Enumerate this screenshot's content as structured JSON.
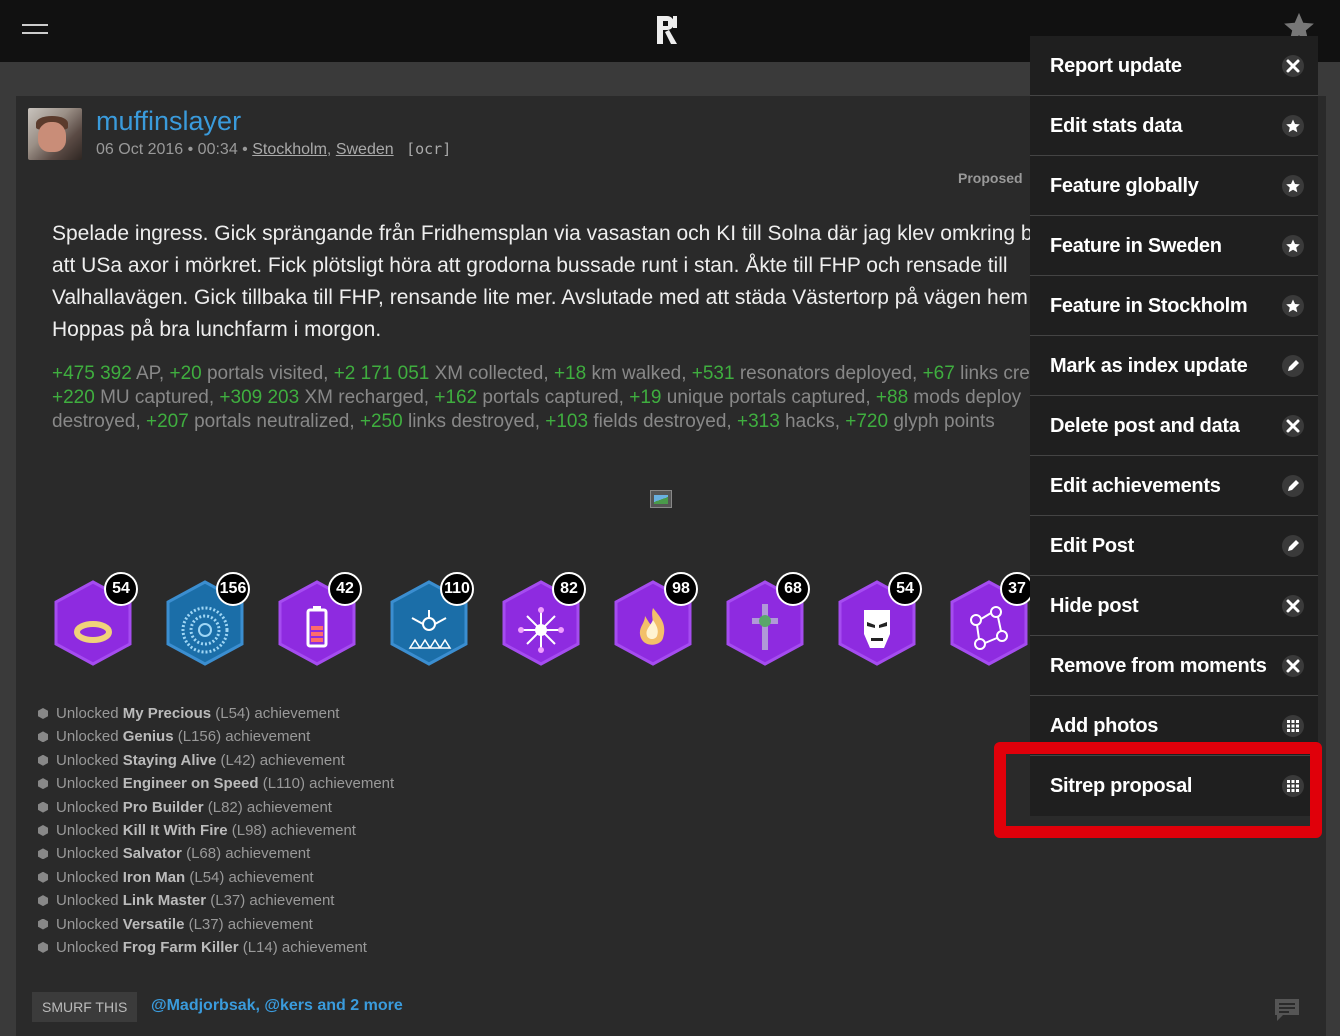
{
  "post": {
    "username": "muffinslayer",
    "date": "06 Oct 2016",
    "time": "00:34",
    "city": "Stockholm",
    "country": "Sweden",
    "ocr_tag": "[ocr]",
    "proposed_label": "Proposed",
    "text_lines": [
      "Spelade ingress. Gick sprängande från Fridhemsplan via vasastan och KI till Solna där jag klev omkring b",
      "att USa axor i mörkret. Fick plötsligt höra att grodorna bussade runt i stan. Åkte till FHP och rensade till",
      "Valhallavägen. Gick tillbaka till FHP, rensande lite mer. Avslutade med att städa Västertorp på vägen hem",
      "Hoppas på bra lunchfarm i morgon."
    ]
  },
  "stats": [
    [
      {
        "v": "+475 392",
        "t": " AP, "
      },
      {
        "v": "+20",
        "t": " portals visited, "
      },
      {
        "v": "+2 171 051",
        "t": " XM collected, "
      },
      {
        "v": "+18",
        "t": " km walked, "
      },
      {
        "v": "+531",
        "t": " resonators deployed, "
      },
      {
        "v": "+67",
        "t": " links cre"
      }
    ],
    [
      {
        "v": "+220",
        "t": " MU captured, "
      },
      {
        "v": "+309 203",
        "t": " XM recharged, "
      },
      {
        "v": "+162",
        "t": " portals captured, "
      },
      {
        "v": "+19",
        "t": " unique portals captured, "
      },
      {
        "v": "+88",
        "t": " mods deploy"
      }
    ],
    [
      {
        "v": "",
        "t": "destroyed, "
      },
      {
        "v": "+207",
        "t": " portals neutralized, "
      },
      {
        "v": "+250",
        "t": " links destroyed, "
      },
      {
        "v": "+103",
        "t": " fields destroyed, "
      },
      {
        "v": "+313",
        "t": " hacks, "
      },
      {
        "v": "+720",
        "t": " glyph points"
      }
    ]
  ],
  "badges": [
    {
      "count": "54",
      "icon": "ring-icon",
      "color": "#8e2be0"
    },
    {
      "count": "156",
      "icon": "genius-icon",
      "color": "#1b6ea8"
    },
    {
      "count": "42",
      "icon": "battery-icon",
      "color": "#8e2be0"
    },
    {
      "count": "110",
      "icon": "engineer-icon",
      "color": "#1b6ea8"
    },
    {
      "count": "82",
      "icon": "builder-icon",
      "color": "#8e2be0"
    },
    {
      "count": "98",
      "icon": "fire-icon",
      "color": "#8e2be0"
    },
    {
      "count": "68",
      "icon": "cross-icon",
      "color": "#8e2be0"
    },
    {
      "count": "54",
      "icon": "iron-man-icon",
      "color": "#8e2be0"
    },
    {
      "count": "37",
      "icon": "link-master-icon",
      "color": "#8e2be0"
    }
  ],
  "achievements": [
    {
      "pre": "Unlocked ",
      "name": "My Precious",
      "post": " (L54) achievement"
    },
    {
      "pre": "Unlocked ",
      "name": "Genius",
      "post": " (L156) achievement"
    },
    {
      "pre": "Unlocked ",
      "name": "Staying Alive",
      "post": " (L42) achievement"
    },
    {
      "pre": "Unlocked ",
      "name": "Engineer on Speed",
      "post": " (L110) achievement"
    },
    {
      "pre": "Unlocked ",
      "name": "Pro Builder",
      "post": " (L82) achievement"
    },
    {
      "pre": "Unlocked ",
      "name": "Kill It With Fire",
      "post": " (L98) achievement"
    },
    {
      "pre": "Unlocked ",
      "name": "Salvator",
      "post": " (L68) achievement"
    },
    {
      "pre": "Unlocked ",
      "name": "Iron Man",
      "post": " (L54) achievement"
    },
    {
      "pre": "Unlocked ",
      "name": "Link Master",
      "post": " (L37) achievement"
    },
    {
      "pre": "Unlocked ",
      "name": "Versatile",
      "post": " (L37) achievement"
    },
    {
      "pre": "Unlocked ",
      "name": "Frog Farm Killer",
      "post": " (L14) achievement"
    }
  ],
  "footer": {
    "smurf_label": "SMURF THIS",
    "smurfer1": "@Madjorbsak",
    "smurfer2": "@kers",
    "more": " and 2 more"
  },
  "menu": [
    {
      "label": "Report update",
      "icon": "close-icon"
    },
    {
      "label": "Edit stats data",
      "icon": "star-icon"
    },
    {
      "label": "Feature globally",
      "icon": "star-icon"
    },
    {
      "label": "Feature in Sweden",
      "icon": "star-icon"
    },
    {
      "label": "Feature in Stockholm",
      "icon": "star-icon"
    },
    {
      "label": "Mark as index update",
      "icon": "pencil-icon"
    },
    {
      "label": "Delete post and data",
      "icon": "close-icon"
    },
    {
      "label": "Edit achievements",
      "icon": "pencil-icon"
    },
    {
      "label": "Edit Post",
      "icon": "pencil-icon"
    },
    {
      "label": "Hide post",
      "icon": "close-icon"
    },
    {
      "label": "Remove from moments",
      "icon": "close-icon"
    },
    {
      "label": "Add photos",
      "icon": "grid-icon"
    },
    {
      "label": "Sitrep proposal",
      "icon": "grid-icon"
    }
  ],
  "colors": {
    "accent": "#3a9bdc",
    "stat_green": "#3fae3f",
    "highlight": "#e0000a"
  }
}
